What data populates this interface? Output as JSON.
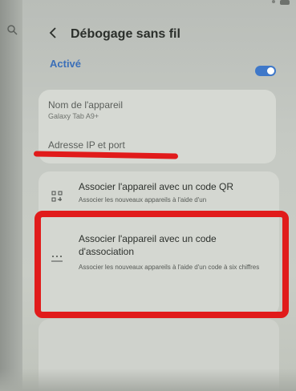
{
  "header": {
    "title": "Débogage sans fil",
    "back_icon": "chevron-left-icon",
    "search_icon": "search-icon"
  },
  "toggle": {
    "label": "Activé",
    "state": "on",
    "accent_color": "#3f78c9"
  },
  "device_card": {
    "name_label": "Nom de l'appareil",
    "name_value": "Galaxy Tab A9+",
    "ip_label": "Adresse IP et port"
  },
  "options": [
    {
      "title": "Associer l'appareil avec un code QR",
      "subtitle": "Associer les nouveaux appareils à l'aide d'un",
      "icon": "qr-code-icon"
    },
    {
      "title": "Associer l'appareil avec un code d'association",
      "subtitle": "Associer les nouveaux appareils à l'aide d'un code à six chiffres",
      "icon": "keypad-dots-icon"
    }
  ],
  "annotations": {
    "highlight_color": "#e11b1b"
  }
}
